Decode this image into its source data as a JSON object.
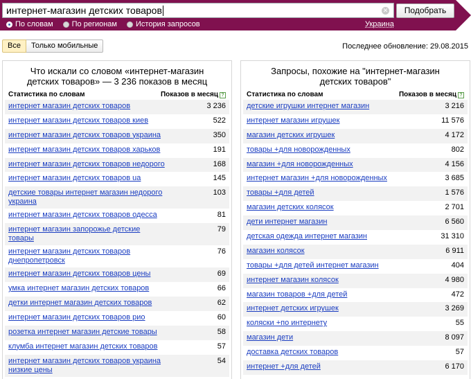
{
  "search": {
    "value": "интернет-магазин детских товаров",
    "clear_icon": "clear-icon",
    "button_label": "Подобрать"
  },
  "modes": [
    {
      "label": "По словам",
      "selected": true
    },
    {
      "label": "По регионам",
      "selected": false
    },
    {
      "label": "История запросов",
      "selected": false
    }
  ],
  "region": "Украина",
  "filters": {
    "all_label": "Все",
    "mobile_label": "Только мобильные"
  },
  "updated": "Последнее обновление: 29.08.2015",
  "colors": {
    "header_bg": "#80114f",
    "link": "#1a3dc1",
    "active_tab": "#fff1c4"
  },
  "left_panel": {
    "title": "Что искали со словом «интернет-магазин детских товаров» — 3 236 показов в месяц",
    "col_query": "Статистика по словам",
    "col_count": "Показов в месяц",
    "rows": [
      {
        "q": "интернет магазин детских товаров",
        "n": "3 236"
      },
      {
        "q": "интернет магазин детских товаров киев",
        "n": "522"
      },
      {
        "q": "интернет магазин детских товаров украина",
        "n": "350"
      },
      {
        "q": "интернет магазин детских товаров харьков",
        "n": "191"
      },
      {
        "q": "интернет магазин детских товаров недорого",
        "n": "168"
      },
      {
        "q": "интернет магазин детских товаров ua",
        "n": "145"
      },
      {
        "q": "детские товары интернет магазин недорого украина",
        "n": "103"
      },
      {
        "q": "интернет магазин детских товаров одесса",
        "n": "81"
      },
      {
        "q": "интернет магазин запорожье детские товары",
        "n": "79"
      },
      {
        "q": "интернет магазин детских товаров днепропетровск",
        "n": "76"
      },
      {
        "q": "интернет магазин детских товаров цены",
        "n": "69"
      },
      {
        "q": "умка интернет магазин детских товаров",
        "n": "66"
      },
      {
        "q": "детки интернет магазин детских товаров",
        "n": "62"
      },
      {
        "q": "интернет магазин детских товаров рио",
        "n": "60"
      },
      {
        "q": "розетка интернет магазин детские товары",
        "n": "58"
      },
      {
        "q": "клумба интернет магазин детских товаров",
        "n": "57"
      },
      {
        "q": "интернет магазин детских товаров украина низкие цены",
        "n": "54"
      }
    ]
  },
  "right_panel": {
    "title": "Запросы, похожие на \"интернет-магазин детских товаров\"",
    "col_query": "Статистика по словам",
    "col_count": "Показов в месяц",
    "rows": [
      {
        "q": "детские игрушки интернет магазин",
        "n": "3 216"
      },
      {
        "q": "интернет магазин игрушек",
        "n": "11 576"
      },
      {
        "q": "магазин детских игрушек",
        "n": "4 172"
      },
      {
        "q": "товары +для новорожденных",
        "n": "802"
      },
      {
        "q": "магазин +для новорожденных",
        "n": "4 156"
      },
      {
        "q": "интернет магазин +для новорожденных",
        "n": "3 685"
      },
      {
        "q": "товары +для детей",
        "n": "1 576"
      },
      {
        "q": "магазин детских колясок",
        "n": "2 701"
      },
      {
        "q": "дети интернет магазин",
        "n": "6 560"
      },
      {
        "q": "детская одежда интернет магазин",
        "n": "31 310"
      },
      {
        "q": "магазин колясок",
        "n": "6 911"
      },
      {
        "q": "товары +для детей интернет магазин",
        "n": "404"
      },
      {
        "q": "интернет магазин колясок",
        "n": "4 980"
      },
      {
        "q": "магазин товаров +для детей",
        "n": "472"
      },
      {
        "q": "интернет детских игрушек",
        "n": "3 269"
      },
      {
        "q": "коляски +по интернету",
        "n": "55"
      },
      {
        "q": "магазин дети",
        "n": "8 097"
      },
      {
        "q": "доставка детских товаров",
        "n": "57"
      },
      {
        "q": "интернет +для детей",
        "n": "6 170"
      }
    ]
  }
}
